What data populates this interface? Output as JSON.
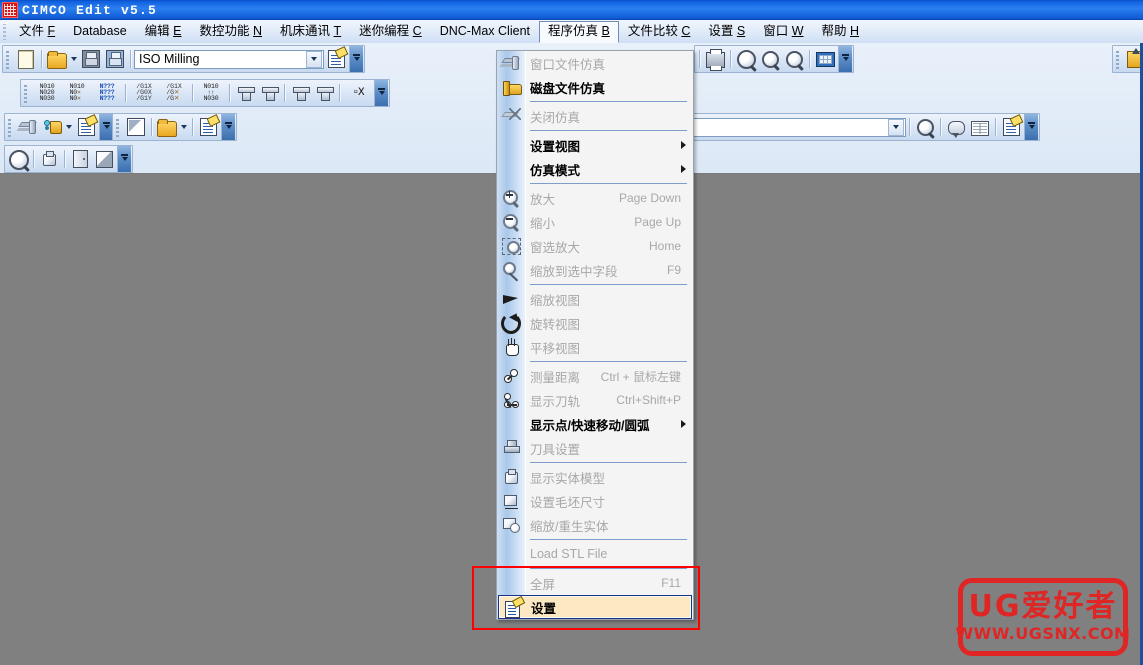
{
  "window": {
    "title": "CIMCO Edit v5.5",
    "icon": "app-icon"
  },
  "menubar": {
    "items": [
      {
        "label": "文件",
        "mnemonic": "F",
        "active": false
      },
      {
        "label": "Database",
        "mnemonic": "",
        "active": false
      },
      {
        "label": "编辑",
        "mnemonic": "E",
        "active": false
      },
      {
        "label": "数控功能",
        "mnemonic": "N",
        "active": false
      },
      {
        "label": "机床通讯",
        "mnemonic": "T",
        "active": false
      },
      {
        "label": "迷你编程",
        "mnemonic": "C",
        "active": false
      },
      {
        "label": "DNC-Max Client",
        "mnemonic": "",
        "active": false
      },
      {
        "label": "程序仿真",
        "mnemonic": "B",
        "active": true
      },
      {
        "label": "文件比较",
        "mnemonic": "C",
        "active": false
      },
      {
        "label": "设置",
        "mnemonic": "S",
        "active": false
      },
      {
        "label": "窗口",
        "mnemonic": "W",
        "active": false
      },
      {
        "label": "帮助",
        "mnemonic": "H",
        "active": false
      }
    ]
  },
  "toolbars": {
    "standard": {
      "buttons": [
        "new-file-icon",
        "open-file-icon",
        "open-file-dropdown",
        "save-icon",
        "save-all-icon"
      ],
      "combo": {
        "value": "ISO Milling",
        "options": [
          "ISO Milling"
        ]
      },
      "after_combo": [
        "file-properties-icon"
      ],
      "overflow": "toolbar-overflow-chevron"
    },
    "print_group": {
      "buttons": [
        "print-icon",
        "zoom-icon",
        "zoom-next-icon",
        "zoom-prev-icon",
        "keypad-icon"
      ],
      "overflow": "toolbar-overflow-chevron"
    },
    "nc_functions": {
      "buttons": [
        "renumber-icon",
        "remove-numbers-icon",
        "find-replace-numbers-icon",
        "g-code-xy-icon",
        "g-code-strike-icon",
        "insert-block-icon",
        "tool-compensation-icon",
        "tool-rotate-icon",
        "tool-down-icon",
        "tool-up-icon",
        "xyz-icon"
      ],
      "overflow": "toolbar-overflow-chevron"
    },
    "machine_group": {
      "buttons": [
        "machine-setup-icon",
        "key-folder-icon",
        "machine-dropdown",
        "machine-properties-icon"
      ],
      "overflow": "toolbar-overflow-chevron"
    },
    "compare_group": {
      "buttons": [
        "compare-file-icon",
        "open-compare-icon",
        "open-compare-dropdown",
        "compare-properties-icon"
      ],
      "overflow": "toolbar-overflow-chevron"
    },
    "search_group": {
      "combo": {
        "value": "",
        "placeholder": ""
      },
      "buttons": [
        "search-icon",
        "comment-icon",
        "table-icon",
        "search-properties-icon"
      ],
      "overflow": "toolbar-overflow-chevron"
    },
    "view_group": {
      "buttons": [
        "preview-icon",
        "transfer-icon",
        "exit-door-icon",
        "panel-icon"
      ],
      "overflow": "toolbar-overflow-chevron"
    },
    "far_right": {
      "buttons": [
        "export-icon"
      ]
    }
  },
  "menu": {
    "name": "程序仿真",
    "items": [
      {
        "id": "win-sim",
        "label": "窗口文件仿真",
        "accel": "",
        "icon": "window-simulate-icon",
        "enabled": false,
        "submenu": false,
        "selected": false
      },
      {
        "id": "disk-sim",
        "label": "磁盘文件仿真",
        "accel": "",
        "icon": "disk-simulate-icon",
        "enabled": true,
        "submenu": false,
        "selected": false
      },
      {
        "sep": true
      },
      {
        "id": "close-sim",
        "label": "关闭仿真",
        "accel": "",
        "icon": "close-simulate-icon",
        "enabled": false,
        "submenu": false,
        "selected": false
      },
      {
        "sep": true
      },
      {
        "id": "set-view",
        "label": "设置视图",
        "accel": "",
        "icon": "",
        "enabled": true,
        "submenu": true,
        "selected": false
      },
      {
        "id": "sim-mode",
        "label": "仿真模式",
        "accel": "",
        "icon": "",
        "enabled": true,
        "submenu": true,
        "selected": false
      },
      {
        "sep": true
      },
      {
        "id": "zoom-in",
        "label": "放大",
        "accel": "Page Down",
        "icon": "zoom-in-icon",
        "enabled": false,
        "submenu": false,
        "selected": false
      },
      {
        "id": "zoom-out",
        "label": "缩小",
        "accel": "Page Up",
        "icon": "zoom-out-icon",
        "enabled": false,
        "submenu": false,
        "selected": false
      },
      {
        "id": "window-zoom",
        "label": "窗选放大",
        "accel": "Home",
        "icon": "window-zoom-icon",
        "enabled": false,
        "submenu": false,
        "selected": false
      },
      {
        "id": "zoom-field",
        "label": "缩放到选中字段",
        "accel": "F9",
        "icon": "zoom-field-icon",
        "enabled": false,
        "submenu": false,
        "selected": false
      },
      {
        "sep": true
      },
      {
        "id": "zoom-view",
        "label": "缩放视图",
        "accel": "",
        "icon": "zoom-view-icon",
        "enabled": false,
        "submenu": false,
        "selected": false
      },
      {
        "id": "rotate-view",
        "label": "旋转视图",
        "accel": "",
        "icon": "rotate-view-icon",
        "enabled": false,
        "submenu": false,
        "selected": false
      },
      {
        "id": "pan-view",
        "label": "平移视图",
        "accel": "",
        "icon": "pan-view-icon",
        "enabled": false,
        "submenu": false,
        "selected": false
      },
      {
        "sep": true
      },
      {
        "id": "measure",
        "label": "测量距离",
        "accel": "Ctrl + 鼠标左键",
        "icon": "measure-icon",
        "enabled": false,
        "submenu": false,
        "selected": false
      },
      {
        "id": "show-path",
        "label": "显示刀轨",
        "accel": "Ctrl+Shift+P",
        "icon": "toolpath-icon",
        "enabled": false,
        "submenu": false,
        "selected": false
      },
      {
        "id": "show-points",
        "label": "显示点/快速移动/圆弧",
        "accel": "",
        "icon": "",
        "enabled": true,
        "submenu": true,
        "selected": false
      },
      {
        "id": "tool-setup",
        "label": "刀具设置",
        "accel": "",
        "icon": "tool-setup-icon",
        "enabled": false,
        "submenu": false,
        "selected": false
      },
      {
        "sep": true
      },
      {
        "id": "show-solid",
        "label": "显示实体模型",
        "accel": "",
        "icon": "solid-model-icon",
        "enabled": false,
        "submenu": false,
        "selected": false
      },
      {
        "id": "stock-size",
        "label": "设置毛坯尺寸",
        "accel": "",
        "icon": "stock-size-icon",
        "enabled": false,
        "submenu": false,
        "selected": false
      },
      {
        "id": "regen-solid",
        "label": "缩放/重生实体",
        "accel": "",
        "icon": "regen-solid-icon",
        "enabled": false,
        "submenu": false,
        "selected": false
      },
      {
        "sep": true
      },
      {
        "id": "load-stl",
        "label": "Load STL File",
        "accel": "",
        "icon": "",
        "enabled": false,
        "submenu": false,
        "selected": false
      },
      {
        "sep": true
      },
      {
        "id": "fullscreen",
        "label": "全屏",
        "accel": "F11",
        "icon": "",
        "enabled": false,
        "submenu": false,
        "selected": false
      },
      {
        "id": "settings",
        "label": "设置",
        "accel": "",
        "icon": "settings-icon",
        "enabled": true,
        "submenu": false,
        "selected": true
      }
    ]
  },
  "annotation": {
    "type": "red-rectangle",
    "color": "#ff0000"
  },
  "watermark": {
    "line1": "UG爱好者",
    "line2": "WWW.UGSNX.COM",
    "color": "#e02525"
  },
  "colors": {
    "titlebar_blue": "#1061e0",
    "menu_highlight": "#fce9c3",
    "menu_highlight_border": "#16338f",
    "desktop_gray": "#808080",
    "toolbar_blue": "#dbe7f6"
  }
}
